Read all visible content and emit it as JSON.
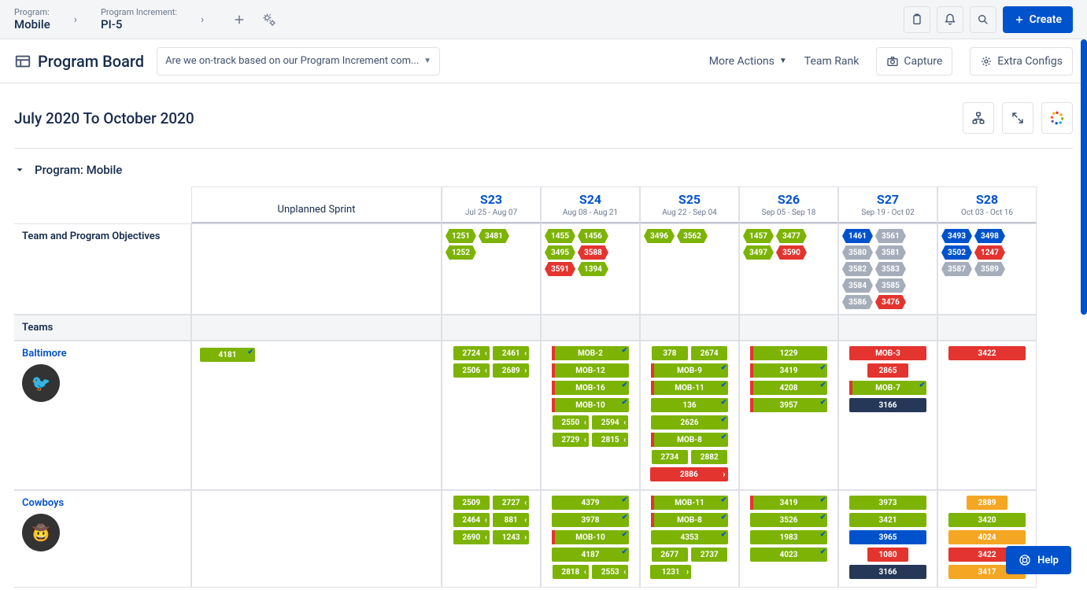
{
  "global": {
    "program_label": "Program:",
    "program_value": "Mobile",
    "pi_label": "Program Increment:",
    "pi_value": "PI-5",
    "create_label": "Create"
  },
  "toolbar": {
    "title": "Program Board",
    "prompt_placeholder": "Are we on-track based on our Program Increment com...",
    "more_actions": "More Actions",
    "team_rank": "Team Rank",
    "capture": "Capture",
    "extra_configs": "Extra Configs"
  },
  "subheader": {
    "range": "July 2020 To October 2020"
  },
  "section": {
    "program_header": "Program: Mobile"
  },
  "columns": {
    "unplanned": "Unplanned Sprint",
    "sprints": [
      {
        "name": "S23",
        "dates": "Jul 25 - Aug 07"
      },
      {
        "name": "S24",
        "dates": "Aug 08 - Aug 21"
      },
      {
        "name": "S25",
        "dates": "Aug 22 - Sep 04"
      },
      {
        "name": "S26",
        "dates": "Sep 05 - Sep 18"
      },
      {
        "name": "S27",
        "dates": "Sep 19 - Oct 02"
      },
      {
        "name": "S28",
        "dates": "Oct 03 - Oct 16"
      }
    ]
  },
  "rows": {
    "objectives_label": "Team and Program Objectives",
    "teams_label": "Teams",
    "objectives": {
      "S23": [
        {
          "t": "1251",
          "c": "green"
        },
        {
          "t": "3481",
          "c": "green"
        },
        {
          "t": "1252",
          "c": "green"
        }
      ],
      "S24": [
        {
          "t": "1455",
          "c": "green"
        },
        {
          "t": "1456",
          "c": "green"
        },
        {
          "t": "3495",
          "c": "green"
        },
        {
          "t": "3588",
          "c": "red"
        },
        {
          "t": "3591",
          "c": "red"
        },
        {
          "t": "1394",
          "c": "green"
        }
      ],
      "S25": [
        {
          "t": "3496",
          "c": "green"
        },
        {
          "t": "3562",
          "c": "green"
        }
      ],
      "S26": [
        {
          "t": "1457",
          "c": "green"
        },
        {
          "t": "3477",
          "c": "green"
        },
        {
          "t": "3497",
          "c": "green"
        },
        {
          "t": "3590",
          "c": "red"
        }
      ],
      "S27": [
        {
          "t": "1461",
          "c": "blue"
        },
        {
          "t": "3561",
          "c": "grey"
        },
        {
          "t": "3580",
          "c": "grey"
        },
        {
          "t": "3581",
          "c": "grey"
        },
        {
          "t": "3582",
          "c": "grey"
        },
        {
          "t": "3583",
          "c": "grey"
        },
        {
          "t": "3584",
          "c": "grey"
        },
        {
          "t": "3585",
          "c": "grey"
        },
        {
          "t": "3586",
          "c": "grey"
        },
        {
          "t": "3476",
          "c": "red"
        }
      ],
      "S28": [
        {
          "t": "3493",
          "c": "blue"
        },
        {
          "t": "3498",
          "c": "blue"
        },
        {
          "t": "3502",
          "c": "blue"
        },
        {
          "t": "1247",
          "c": "red"
        },
        {
          "t": "3587",
          "c": "grey"
        },
        {
          "t": "3589",
          "c": "grey"
        }
      ]
    },
    "teams": [
      {
        "name": "Baltimore",
        "avatar": "🐦",
        "unplanned": [
          {
            "t": "4181",
            "c": "green",
            "chk": true
          }
        ],
        "sprints": {
          "S23": {
            "pairs": [
              [
                "2724",
                "2461"
              ],
              [
                "2506",
                "2689"
              ]
            ],
            "arrows": [
              "l",
              "l",
              "l",
              "r"
            ]
          },
          "S24": {
            "full": [
              {
                "t": "MOB-2",
                "c": "green",
                "flag": "red",
                "chk": true
              },
              {
                "t": "MOB-12",
                "c": "green",
                "flag": "red"
              },
              {
                "t": "MOB-16",
                "c": "green",
                "flag": "red",
                "chk": true
              },
              {
                "t": "MOB-10",
                "c": "green",
                "flag": "red",
                "chk": true
              }
            ],
            "pairs": [
              [
                "2550",
                "2594"
              ],
              [
                "2729",
                "2815"
              ]
            ],
            "arrows": [
              "l",
              "l",
              "l",
              "l"
            ]
          },
          "S25": {
            "pairs_top": [
              [
                "378",
                "2674"
              ]
            ],
            "full": [
              {
                "t": "MOB-9",
                "c": "green",
                "flag": "red",
                "chk": true
              },
              {
                "t": "MOB-11",
                "c": "green",
                "flag": "red",
                "chk": true
              },
              {
                "t": "136",
                "c": "green",
                "chk": true
              },
              {
                "t": "2626",
                "c": "green",
                "chk": true
              },
              {
                "t": "MOB-8",
                "c": "green",
                "flag": "red",
                "chk": true
              }
            ],
            "pairs": [
              [
                "2734",
                "2882"
              ]
            ],
            "bottom": [
              {
                "t": "2886",
                "c": "red",
                "arrow": "r"
              }
            ]
          },
          "S26": {
            "full": [
              {
                "t": "1229",
                "c": "green",
                "flag": "red"
              },
              {
                "t": "3419",
                "c": "green",
                "flag": "red",
                "chk": true
              },
              {
                "t": "4208",
                "c": "green",
                "flag": "red",
                "chk": true
              },
              {
                "t": "3957",
                "c": "green",
                "flag": "red",
                "chk": true
              }
            ]
          },
          "S27": {
            "full": [
              {
                "t": "MOB-3",
                "c": "red"
              },
              {
                "t": "2865",
                "c": "red",
                "narrow": true
              },
              {
                "t": "MOB-7",
                "c": "green",
                "flag": "red",
                "chk": true
              },
              {
                "t": "3166",
                "c": "dark"
              }
            ]
          },
          "S28": {
            "full": [
              {
                "t": "3422",
                "c": "red"
              }
            ]
          }
        }
      },
      {
        "name": "Cowboys",
        "avatar": "🤠",
        "unplanned": [],
        "sprints": {
          "S23": {
            "pairs": [
              [
                "2509",
                "2727"
              ],
              [
                "2464",
                "881"
              ],
              [
                "2690",
                "1243"
              ]
            ],
            "arrows": [
              "",
              "l",
              "l",
              "l",
              "l",
              "r"
            ]
          },
          "S24": {
            "full": [
              {
                "t": "4379",
                "c": "green",
                "chk": true
              },
              {
                "t": "3978",
                "c": "green",
                "chk": true
              },
              {
                "t": "MOB-10",
                "c": "green",
                "flag": "red",
                "chk": true
              },
              {
                "t": "4187",
                "c": "green",
                "chk": true
              }
            ],
            "pairs": [
              [
                "2818",
                "2553"
              ]
            ],
            "arrows": [
              "l",
              "l"
            ]
          },
          "S25": {
            "full": [
              {
                "t": "MOB-11",
                "c": "green",
                "flag": "red",
                "chk": true
              },
              {
                "t": "MOB-8",
                "c": "green",
                "flag": "red",
                "chk": true
              },
              {
                "t": "4353",
                "c": "green",
                "chk": true
              }
            ],
            "pairs": [
              [
                "2677",
                "2737"
              ]
            ],
            "bottom": [
              {
                "t": "1231",
                "c": "green",
                "narrow": true,
                "arrow": "r"
              }
            ]
          },
          "S26": {
            "full": [
              {
                "t": "3419",
                "c": "green",
                "flag": "red",
                "chk": true
              },
              {
                "t": "3526",
                "c": "green",
                "chk": true
              },
              {
                "t": "1983",
                "c": "green",
                "chk": true
              },
              {
                "t": "4023",
                "c": "green",
                "chk": true
              }
            ]
          },
          "S27": {
            "full": [
              {
                "t": "3973",
                "c": "green"
              },
              {
                "t": "3421",
                "c": "green"
              },
              {
                "t": "3965",
                "c": "blue"
              },
              {
                "t": "1080",
                "c": "red",
                "narrow": true
              },
              {
                "t": "3166",
                "c": "dark"
              }
            ]
          },
          "S28": {
            "full": [
              {
                "t": "2889",
                "c": "orange",
                "narrow": true
              },
              {
                "t": "3420",
                "c": "green"
              },
              {
                "t": "4024",
                "c": "orange"
              },
              {
                "t": "3422",
                "c": "red"
              },
              {
                "t": "3417",
                "c": "orange"
              }
            ]
          }
        }
      }
    ]
  },
  "help": "Help"
}
